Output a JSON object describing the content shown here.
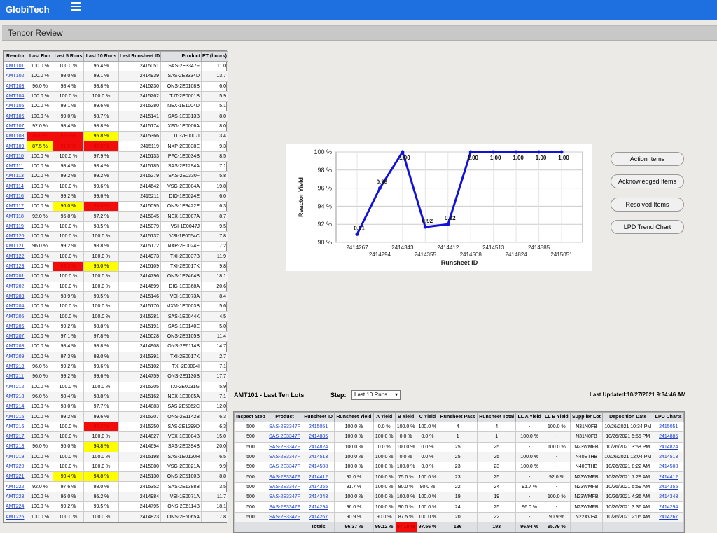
{
  "app": {
    "brand": "GlobiTech"
  },
  "page": {
    "title": "Tencor Review"
  },
  "reactor_table": {
    "headers": [
      "Reactor",
      "Last Run",
      "Last 5 Runs",
      "Last 10 Runs",
      "Last Runsheet ID",
      "Product",
      "ET (hours)"
    ],
    "rows": [
      [
        "AMT101",
        "100.0 %",
        "100.0 %",
        "96.4 %",
        "2415051",
        "SAS-2E3347F",
        "11.0"
      ],
      [
        "AMT102",
        "100.0 %",
        "98.0 %",
        "99.1 %",
        "2414939",
        "SAS-2E3334D",
        "13.7"
      ],
      [
        "AMT103",
        "96.0 %",
        "98.4 %",
        "98.8 %",
        "2415230",
        "ONS-2E0108B",
        "6.0"
      ],
      [
        "AMT104",
        "100.0 %",
        "100.0 %",
        "100.0 %",
        "2415262",
        "TJT-2E0001B",
        "5.9"
      ],
      [
        "AMT105",
        "100.0 %",
        "99.1 %",
        "99.6 %",
        "2415280",
        "NEX-1E1004D",
        "5.1"
      ],
      [
        "AMT106",
        "100.0 %",
        "99.0 %",
        "98.7 %",
        "2415141",
        "SAS-1E0313B",
        "8.0"
      ],
      [
        "AMT107",
        "92.0 %",
        "98.4 %",
        "98.8 %",
        "2415174",
        "XFG-1E0006A",
        "8.0"
      ],
      [
        "AMT108",
        "80.0 %",
        "93.5 %",
        "95.8 %",
        "2415366",
        "TU-2E0007I",
        "3.4"
      ],
      [
        "AMT109",
        "87.5 %",
        "91.8 %",
        "87.0 %",
        "2415119",
        "NXP-2E0038E",
        "9.3"
      ],
      [
        "AMT110",
        "100.0 %",
        "100.0 %",
        "97.9 %",
        "2415133",
        "PFC-1E0034B",
        "8.5"
      ],
      [
        "AMT111",
        "100.0 %",
        "98.4 %",
        "98.4 %",
        "2415185",
        "SAS-2E1294A",
        "7.1"
      ],
      [
        "AMT113",
        "100.0 %",
        "99.2 %",
        "99.2 %",
        "2415279",
        "SAS-2E0330F",
        "5.8"
      ],
      [
        "AMT114",
        "100.0 %",
        "100.0 %",
        "99.6 %",
        "2414642",
        "VSG-2E0004A",
        "19.8"
      ],
      [
        "AMT116",
        "100.0 %",
        "99.2 %",
        "99.6 %",
        "2415211",
        "DIO-1E0024E",
        "6.0"
      ],
      [
        "AMT117",
        "100.0 %",
        "96.0 %",
        "94.6 %",
        "2415095",
        "ONS-1E3422E",
        "6.3"
      ],
      [
        "AMT118",
        "92.0 %",
        "96.8 %",
        "97.2 %",
        "2415045",
        "NEX-1E3007A",
        "8.7"
      ],
      [
        "AMT119",
        "100.0 %",
        "100.0 %",
        "98.5 %",
        "2415079",
        "VSI-1E0047J",
        "9.5"
      ],
      [
        "AMT120",
        "100.0 %",
        "100.0 %",
        "100.0 %",
        "2415137",
        "VSI-1E0054C",
        "7.8"
      ],
      [
        "AMT121",
        "96.0 %",
        "99.2 %",
        "98.8 %",
        "2415172",
        "NXP-2E0024E",
        "7.2"
      ],
      [
        "AMT122",
        "100.0 %",
        "100.0 %",
        "100.0 %",
        "2414973",
        "TXI-2E0037B",
        "11.9"
      ],
      [
        "AMT123",
        "100.0 %",
        "93.3 %",
        "95.0 %",
        "2415109",
        "TXI-2E0017K",
        "9.8"
      ],
      [
        "AMT201",
        "100.0 %",
        "100.0 %",
        "100.0 %",
        "2414796",
        "ONS-1E2464B",
        "18.1"
      ],
      [
        "AMT202",
        "100.0 %",
        "100.0 %",
        "100.0 %",
        "2414699",
        "DIG-1E0368A",
        "20.6"
      ],
      [
        "AMT203",
        "100.0 %",
        "98.9 %",
        "99.5 %",
        "2415146",
        "VSI-1E0073A",
        "8.4"
      ],
      [
        "AMT204",
        "100.0 %",
        "100.0 %",
        "100.0 %",
        "2415170",
        "MXM-1E0003B",
        "5.6"
      ],
      [
        "AMT205",
        "100.0 %",
        "100.0 %",
        "100.0 %",
        "2415281",
        "SAS-1E0044K",
        "4.5"
      ],
      [
        "AMT206",
        "100.0 %",
        "99.2 %",
        "98.8 %",
        "2415191",
        "SAS-1E0140E",
        "5.0"
      ],
      [
        "AMT207",
        "100.0 %",
        "97.1 %",
        "97.8 %",
        "2415028",
        "ONS-2E5105B",
        "11.4"
      ],
      [
        "AMT208",
        "100.0 %",
        "98.4 %",
        "98.8 %",
        "2414908",
        "ONS-2E6114B",
        "14.7"
      ],
      [
        "AMT209",
        "100.0 %",
        "97.3 %",
        "98.0 %",
        "2415391",
        "TXI-2E0017K",
        "2.7"
      ],
      [
        "AMT210",
        "96.0 %",
        "99.2 %",
        "99.6 %",
        "2415102",
        "TXI-2E0004I",
        "7.1"
      ],
      [
        "AMT211",
        "96.0 %",
        "99.2 %",
        "99.6 %",
        "2414759",
        "ONS-2E1130B",
        "17.7"
      ],
      [
        "AMT212",
        "100.0 %",
        "100.0 %",
        "100.0 %",
        "2415205",
        "TXI-2E0031G",
        "5.9"
      ],
      [
        "AMT213",
        "96.0 %",
        "98.4 %",
        "98.8 %",
        "2415162",
        "NEX-1E3005A",
        "7.1"
      ],
      [
        "AMT214",
        "100.0 %",
        "98.0 %",
        "97.7 %",
        "2414883",
        "SAS-2E5062C",
        "12.0"
      ],
      [
        "AMT215",
        "100.0 %",
        "99.2 %",
        "99.6 %",
        "2415207",
        "ONS-2E1142B",
        "6.3"
      ],
      [
        "AMT216",
        "100.0 %",
        "100.0 %",
        "94.2 %",
        "2415250",
        "SAS-2E1299D",
        "6.3"
      ],
      [
        "AMT217",
        "100.0 %",
        "100.0 %",
        "100.0 %",
        "2414827",
        "VSX-1E0004B",
        "15.0"
      ],
      [
        "AMT218",
        "96.0 %",
        "96.0 %",
        "94.8 %",
        "2414694",
        "SAS-2E0394B",
        "20.0"
      ],
      [
        "AMT219",
        "100.0 %",
        "100.0 %",
        "100.0 %",
        "2415198",
        "SAS-1E0120H",
        "6.5"
      ],
      [
        "AMT220",
        "100.0 %",
        "100.0 %",
        "100.0 %",
        "2415080",
        "VSG-2E0021A",
        "9.9"
      ],
      [
        "AMT221",
        "100.0 %",
        "90.4 %",
        "94.8 %",
        "2415130",
        "ONS-2E5100B",
        "8.8"
      ],
      [
        "AMT222",
        "92.0 %",
        "97.6 %",
        "98.0 %",
        "2415352",
        "SAS-2E1388B",
        "3.5"
      ],
      [
        "AMT223",
        "100.0 %",
        "96.0 %",
        "95.2 %",
        "2414984",
        "VSI-1E0071A",
        "11.7"
      ],
      [
        "AMT224",
        "100.0 %",
        "99.2 %",
        "99.5 %",
        "2414795",
        "ONS-2E6114B",
        "18.1"
      ],
      [
        "AMT225",
        "100.0 %",
        "100.0 %",
        "100.0 %",
        "2414823",
        "ONS-2E6065A",
        "17.8"
      ]
    ],
    "highlights": {
      "AMT108": [
        "red",
        "red",
        "yel"
      ],
      "AMT109": [
        "yel",
        "red",
        "red"
      ],
      "AMT117": [
        null,
        "yel",
        "red"
      ],
      "AMT123": [
        null,
        "red",
        "yel"
      ],
      "AMT216": [
        null,
        null,
        "red"
      ],
      "AMT218": [
        null,
        null,
        "yel"
      ],
      "AMT221": [
        null,
        "yel",
        "yel"
      ]
    }
  },
  "chart_data": {
    "type": "line",
    "xlabel": "Runsheet ID",
    "ylabel": "Reactor Yield",
    "ylim": [
      90,
      100
    ],
    "yticks": [
      "90 %",
      "92 %",
      "94 %",
      "96 %",
      "98 %",
      "100 %"
    ],
    "categories": [
      "2414267",
      "2414294",
      "2414343",
      "2414355",
      "2414412",
      "2414508",
      "2414513",
      "2414824",
      "2414885",
      "2415051"
    ],
    "values": [
      90.9,
      96.0,
      100.0,
      91.7,
      92.0,
      100.0,
      100.0,
      100.0,
      100.0,
      100.0
    ],
    "data_labels": [
      "0.91",
      "0.96",
      "1.00",
      "0.92",
      "0.92",
      "1.00",
      "1.00",
      "1.00",
      "1.00",
      "1.00"
    ],
    "grid": true,
    "line_color": "#1212d6"
  },
  "actions": {
    "action_items": "Action Items",
    "acknowledged_items": "Acknowledged Items",
    "resolved_items": "Resolved Items",
    "lpd_trend_chart": "LPD Trend Chart"
  },
  "lots_section": {
    "title": "AMT101 - Last Ten Lots",
    "step_label": "Step:",
    "step_value": "Last 10 Runs",
    "last_updated": "Last Updated:10/27/2021 9:34:46 AM"
  },
  "lots_table": {
    "headers": [
      "Inspect Step",
      "Product",
      "Runsheet ID",
      "Runsheet Yield",
      "A Yield",
      "B Yield",
      "C Yield",
      "Runsheet Pass",
      "Runsheet Total",
      "LL A Yield",
      "LL B Yield",
      "Supplier Lot",
      "Deposition Date",
      "LPD Charts"
    ],
    "rows": [
      [
        "500",
        "SAS-2E3347F",
        "2415051",
        "100.0 %",
        "0.0 %",
        "100.0 %",
        "100.0 %",
        "4",
        "4",
        "-",
        "100.0 %",
        "N31N0FB",
        "10/26/2021 10:34 PM",
        "2415051"
      ],
      [
        "500",
        "SAS-2E3347F",
        "2414885",
        "100.0 %",
        "100.0 %",
        "0.0 %",
        "0.0 %",
        "1",
        "1",
        "100.0 %",
        "-",
        "N31N0FB",
        "10/26/2021 5:55 PM",
        "2414885"
      ],
      [
        "500",
        "SAS-2E3347F",
        "2414824",
        "100.0 %",
        "0.0 %",
        "100.0 %",
        "0.0 %",
        "25",
        "25",
        "-",
        "100.0 %",
        "N23WMFB",
        "10/26/2021 3:58 PM",
        "2414824"
      ],
      [
        "500",
        "SAS-2E3347F",
        "2414513",
        "100.0 %",
        "100.0 %",
        "0.0 %",
        "0.0 %",
        "25",
        "25",
        "100.0 %",
        "-",
        "N40ETHB",
        "10/26/2021 12:04 PM",
        "2414513"
      ],
      [
        "500",
        "SAS-2E3347F",
        "2414508",
        "100.0 %",
        "100.0 %",
        "100.0 %",
        "0.0 %",
        "23",
        "23",
        "100.0 %",
        "-",
        "N40ETHB",
        "10/26/2021 8:22 AM",
        "2414508"
      ],
      [
        "500",
        "SAS-2E3347F",
        "2414412",
        "92.0 %",
        "100.0 %",
        "75.0 %",
        "100.0 %",
        "23",
        "25",
        "-",
        "92.0 %",
        "N23WMFB",
        "10/26/2021 7:29 AM",
        "2414412"
      ],
      [
        "500",
        "SAS-2E3347F",
        "2414355",
        "91.7 %",
        "100.0 %",
        "80.0 %",
        "90.0 %",
        "22",
        "24",
        "91.7 %",
        "-",
        "N23WMFB",
        "10/26/2021 5:59 AM",
        "2414355"
      ],
      [
        "500",
        "SAS-2E3347F",
        "2414343",
        "100.0 %",
        "100.0 %",
        "100.0 %",
        "100.0 %",
        "19",
        "19",
        "-",
        "100.0 %",
        "N23WMFB",
        "10/26/2021 4:36 AM",
        "2414343"
      ],
      [
        "500",
        "SAS-2E3347F",
        "2414294",
        "96.0 %",
        "100.0 %",
        "90.0 %",
        "100.0 %",
        "24",
        "25",
        "96.0 %",
        "-",
        "N23WMFB",
        "10/26/2021 3:36 AM",
        "2414294"
      ],
      [
        "500",
        "SAS-2E3347F",
        "2414267",
        "90.9 %",
        "90.0 %",
        "87.5 %",
        "100.0 %",
        "20",
        "22",
        "-",
        "90.9 %",
        "N22XVEA",
        "10/26/2021 2:05 AM",
        "2414267"
      ]
    ],
    "totals": {
      "label": "Totals",
      "runsheet_yield": "96.37 %",
      "a_yield": "99.12 %",
      "b_yield": "87.18 %",
      "c_yield": "97.56 %",
      "pass": "186",
      "total": "193",
      "ll_a": "96.94 %",
      "ll_b": "95.79 %"
    }
  }
}
